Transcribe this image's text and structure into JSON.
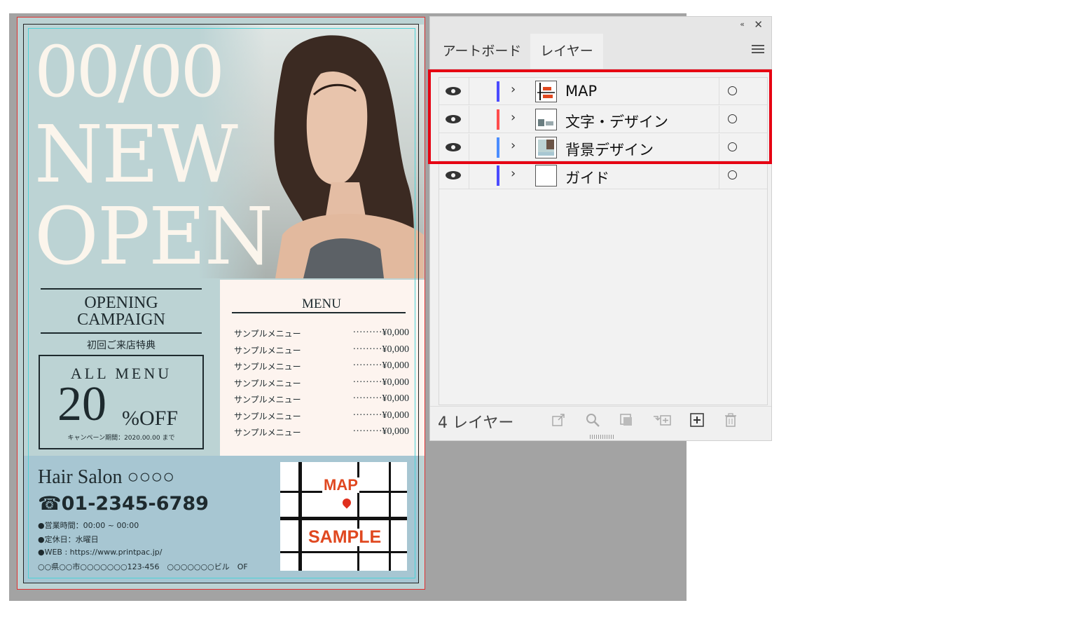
{
  "flyer": {
    "big_date": "00/00",
    "big_new": "NEW",
    "big_open": "OPEN",
    "campaign_title_line1": "OPENING",
    "campaign_title_line2": "CAMPAIGN",
    "campaign_subtitle": "初回ご来店特典",
    "offer_label": "ALL MENU",
    "offer_number": "20",
    "offer_unit": "%OFF",
    "offer_period": "キャンペーン期間：2020.00.00 まで",
    "menu_title": "MENU",
    "menu_items": [
      {
        "name": "サンプルメニュー",
        "price": "·········¥0,000"
      },
      {
        "name": "サンプルメニュー",
        "price": "·········¥0,000"
      },
      {
        "name": "サンプルメニュー",
        "price": "·········¥0,000"
      },
      {
        "name": "サンプルメニュー",
        "price": "·········¥0,000"
      },
      {
        "name": "サンプルメニュー",
        "price": "·········¥0,000"
      },
      {
        "name": "サンプルメニュー",
        "price": "·········¥0,000"
      },
      {
        "name": "サンプルメニュー",
        "price": "·········¥0,000"
      }
    ],
    "salon_name": "Hair Salon ○○○○",
    "phone": "☎01-2345-6789",
    "hours": "●営業時間：00:00 ~ 00:00",
    "closed": "●定休日：水曜日",
    "web": "●WEB : https://www.printpac.jp/",
    "address": "○○県○○市○○○○○○○123-456　○○○○○○○ビル　OF",
    "map_label": "MAP",
    "map_sample": "SAMPLE"
  },
  "panel": {
    "collapse_icon": "«",
    "close_icon": "✕",
    "tab_artboard": "アートボード",
    "tab_layers": "レイヤー",
    "layers": [
      {
        "name": "MAP",
        "color": "#4b4bff",
        "chevron": "›"
      },
      {
        "name": "文字・デザイン",
        "color": "#ff4d4d",
        "chevron": "›"
      },
      {
        "name": "背景デザイン",
        "color": "#4b8dff",
        "chevron": "›"
      },
      {
        "name": "ガイド",
        "color": "#4b4bff",
        "chevron": "›"
      }
    ],
    "footer_count": "4 レイヤー"
  },
  "colors": {
    "highlight": "#e60012",
    "artboard_bg": "#bcd3d4",
    "menu_bg": "#fdf4ef",
    "band_bg": "#a7c6d2"
  }
}
